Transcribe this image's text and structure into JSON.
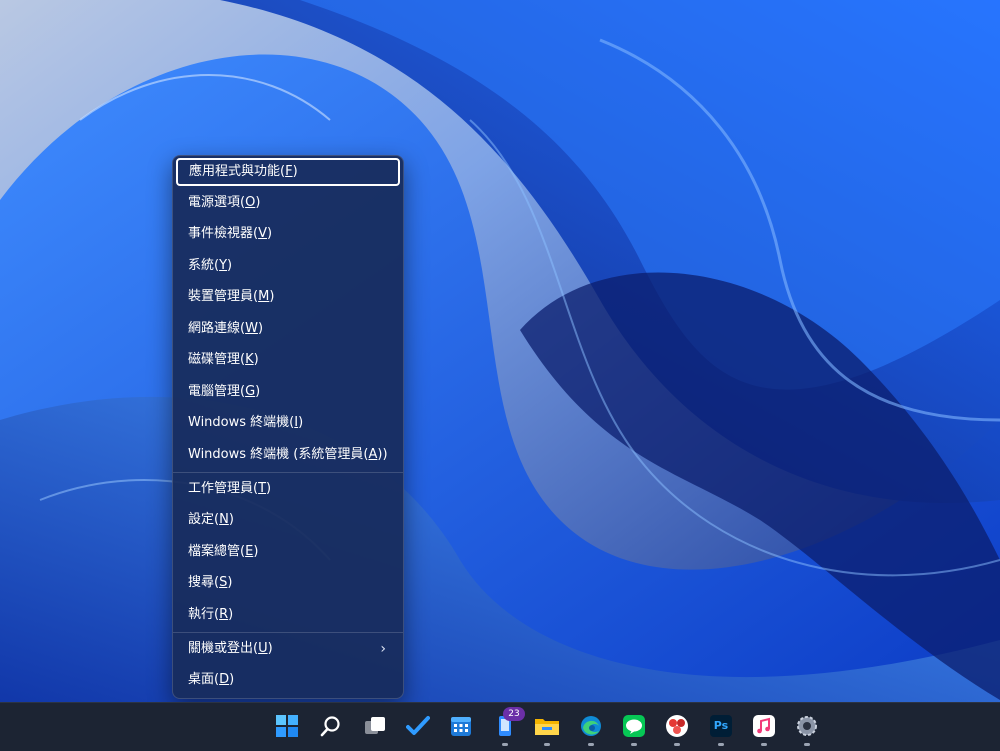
{
  "context_menu": {
    "items": [
      {
        "label": "應用程式與功能",
        "accel": "F"
      },
      {
        "label": "電源選項",
        "accel": "O"
      },
      {
        "label": "事件檢視器",
        "accel": "V"
      },
      {
        "label": "系統",
        "accel": "Y"
      },
      {
        "label": "裝置管理員",
        "accel": "M"
      },
      {
        "label": "網路連線",
        "accel": "W"
      },
      {
        "label": "磁碟管理",
        "accel": "K"
      },
      {
        "label": "電腦管理",
        "accel": "G"
      },
      {
        "label": "Windows 終端機",
        "accel": "I"
      },
      {
        "label": "Windows 終端機 (系統管理員",
        "accel": "A",
        "suffix": ")"
      },
      {
        "label": "工作管理員",
        "accel": "T"
      },
      {
        "label": "設定",
        "accel": "N"
      },
      {
        "label": "檔案總管",
        "accel": "E"
      },
      {
        "label": "搜尋",
        "accel": "S"
      },
      {
        "label": "執行",
        "accel": "R"
      },
      {
        "label": "關機或登出",
        "accel": "U"
      },
      {
        "label": "桌面",
        "accel": "D"
      }
    ],
    "submenu_arrow": "›"
  },
  "taskbar": {
    "store_badge": "23",
    "icons": [
      "windows-start-icon",
      "search-icon",
      "task-view-icon",
      "todo-icon",
      "calendar-icon",
      "store-icon",
      "file-explorer-icon",
      "edge-icon",
      "line-icon",
      "app-icon",
      "photoshop-icon",
      "itunes-icon",
      "settings-icon"
    ],
    "photoshop_label": "Ps"
  },
  "colors": {
    "menu_bg": "#172c5c",
    "taskbar_bg": "#1c2433",
    "accent": "#0078d4"
  }
}
